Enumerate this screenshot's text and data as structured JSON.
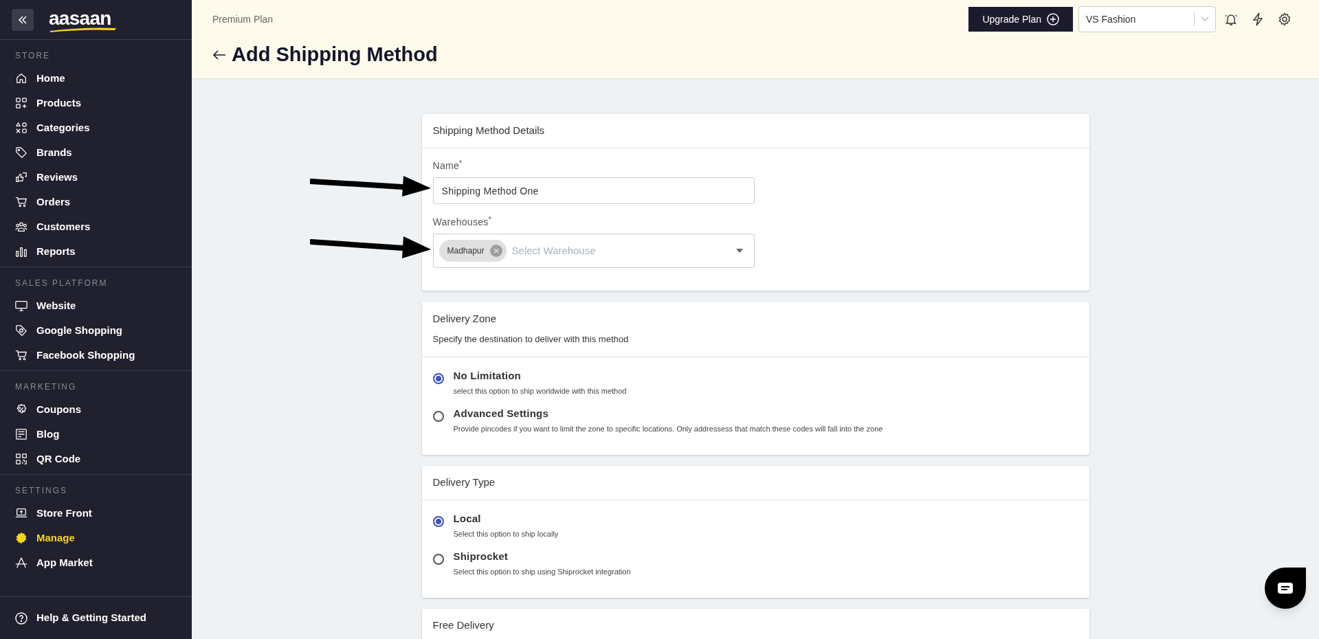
{
  "sidebar": {
    "logo": "aasaan",
    "sections": [
      {
        "title": "STORE",
        "items": [
          {
            "label": "Home",
            "kind": "home",
            "selected": false
          },
          {
            "label": "Products",
            "kind": "products",
            "selected": false
          },
          {
            "label": "Categories",
            "kind": "categories",
            "selected": false
          },
          {
            "label": "Brands",
            "kind": "tag",
            "selected": false
          },
          {
            "label": "Reviews",
            "kind": "reviews",
            "selected": false
          },
          {
            "label": "Orders",
            "kind": "cart",
            "selected": false
          },
          {
            "label": "Customers",
            "kind": "users",
            "selected": false
          },
          {
            "label": "Reports",
            "kind": "bars",
            "selected": false
          }
        ]
      },
      {
        "title": "SALES PLATFORM",
        "items": [
          {
            "label": "Website",
            "kind": "monitor",
            "selected": false
          },
          {
            "label": "Google Shopping",
            "kind": "gtag",
            "selected": false
          },
          {
            "label": "Facebook Shopping",
            "kind": "cart",
            "selected": false
          }
        ]
      },
      {
        "title": "MARKETING",
        "items": [
          {
            "label": "Coupons",
            "kind": "coupon",
            "selected": false
          },
          {
            "label": "Blog",
            "kind": "blog",
            "selected": false
          },
          {
            "label": "QR Code",
            "kind": "qr",
            "selected": false
          }
        ]
      },
      {
        "title": "SETTINGS",
        "items": [
          {
            "label": "Store Front",
            "kind": "laptop",
            "selected": false
          },
          {
            "label": "Manage",
            "kind": "gear",
            "selected": true
          },
          {
            "label": "App Market",
            "kind": "appmarket",
            "selected": false
          }
        ]
      }
    ],
    "help": "Help & Getting Started"
  },
  "header": {
    "plan": "Premium Plan",
    "upgrade_button": "Upgrade Plan",
    "store_select": "VS Fashion",
    "title": "Add Shipping Method"
  },
  "cards": [
    {
      "kind": "fields",
      "title": "Shipping Method Details",
      "fields": [
        {
          "kind": "text",
          "label": "Name$^{*}$",
          "value": "Shipping Method One"
        },
        {
          "kind": "multiselect",
          "label": "Warehouses$^{*}$",
          "tags": [
            "Madhapur"
          ],
          "placeholder": "Select Warehouse"
        }
      ]
    },
    {
      "kind": "radios",
      "title": "Delivery Zone",
      "subtitle": "Specify the destination to deliver with this method",
      "options": [
        {
          "label": "No Limitation",
          "description": "select this option to ship worldwide with this method",
          "selected": true
        },
        {
          "label": "Advanced Settings",
          "description": "Provide pincodes if you want to limit the zone to specific locations. Only addressess that match these codes will fall into the zone",
          "selected": false
        }
      ]
    },
    {
      "kind": "radios",
      "title": "Delivery Type",
      "options": [
        {
          "label": "Local",
          "description": "Select this option to ship locally",
          "selected": true
        },
        {
          "label": "Shiprocket",
          "description": "Select this option to ship using Shiprocket integration",
          "selected": false
        }
      ]
    },
    {
      "kind": "radios",
      "title": "Free Delivery"
    }
  ]
}
